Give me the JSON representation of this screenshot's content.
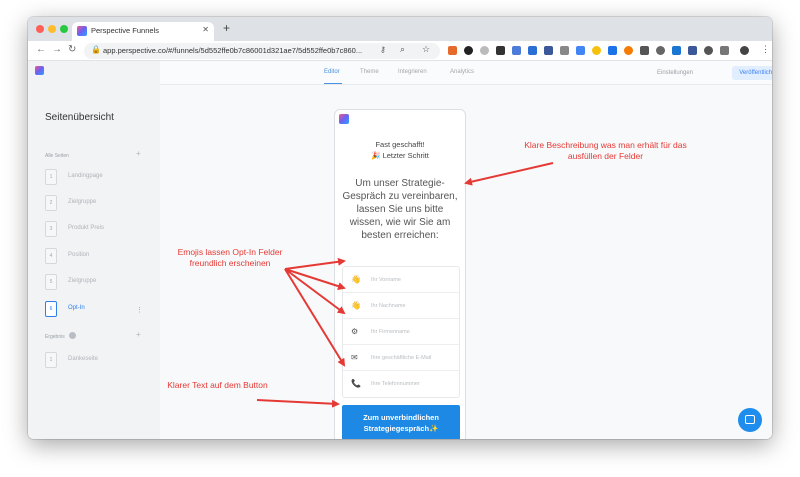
{
  "browser": {
    "tab_title": "Perspective Funnels",
    "url": "app.perspective.co/#/funnels/5d552ffe0b7c86001d321ae7/5d552ffe0b7c860..."
  },
  "sidebar": {
    "heading": "Seitenübersicht",
    "all_pages_label": "Alle Seiten",
    "results_label": "Ergebnis",
    "pages": [
      {
        "num": "1",
        "label": "Landingpage"
      },
      {
        "num": "2",
        "label": "Zielgruppe"
      },
      {
        "num": "3",
        "label": "Produkt Preis"
      },
      {
        "num": "4",
        "label": "Position"
      },
      {
        "num": "5",
        "label": "Zielgruppe"
      },
      {
        "num": "6",
        "label": "Opt-In"
      }
    ],
    "result_pages": [
      {
        "num": "1",
        "label": "Dankeseite"
      }
    ]
  },
  "topnav": {
    "tabs": [
      "Editor",
      "Theme",
      "Integrieren",
      "Analytics"
    ],
    "settings": "Einstellungen",
    "publish": "Veröffentlichen"
  },
  "page": {
    "subtitle1": "Fast geschafft!",
    "subtitle2": "🎉 Letzter Schritt",
    "headline": "Um unser Strategie-Gespräch zu vereinbaren, lassen Sie uns bitte wissen, wie wir Sie am besten erreichen:",
    "fields": [
      {
        "emoji": "👋",
        "placeholder": "Ihr Vorname"
      },
      {
        "emoji": "👋",
        "placeholder": "Ihr Nachname"
      },
      {
        "emoji": "⚙",
        "placeholder": "Ihr Firmenname"
      },
      {
        "emoji": "✉",
        "placeholder": "Ihre geschäftliche E-Mail"
      },
      {
        "emoji": "📞",
        "placeholder": "Ihre Telefonnummer"
      }
    ],
    "cta_line1": "Zum unverbindlichen",
    "cta_line2": "Strategiegespräch✨"
  },
  "annotations": {
    "description": "Klare Beschreibung was man erhält für das ausfüllen der Felder",
    "emojis": "Emojis lassen Opt-In Felder freundlich erscheinen",
    "button": "Klarer Text auf dem Button"
  },
  "colors": {
    "accent": "#1e88e5",
    "annotation": "#e53935"
  }
}
